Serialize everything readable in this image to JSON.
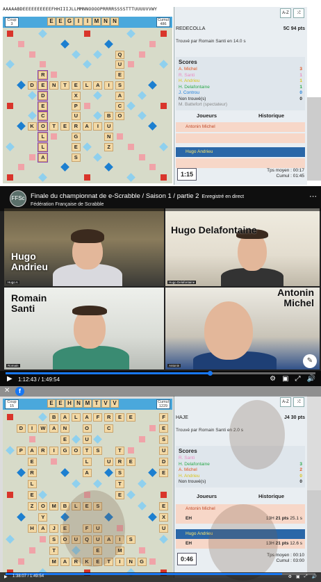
{
  "game1": {
    "letter_pool": "AAAAABDEEEEEEEEEEFHHIIIJLLMMNNOOOOPRRRRSSSSTTTUUUUVVWY",
    "coup_label": "Coup",
    "coup_value": "3",
    "cumul_label": "Cumul",
    "cumul_value": "486",
    "rack": [
      "E",
      "E",
      "G",
      "I",
      "I",
      "M",
      "N",
      "N"
    ],
    "board": [
      {
        "r": 2,
        "c": 10,
        "t": "Q"
      },
      {
        "r": 3,
        "c": 10,
        "t": "U"
      },
      {
        "r": 4,
        "c": 10,
        "t": "E"
      },
      {
        "r": 4,
        "c": 3,
        "t": "R"
      },
      {
        "r": 5,
        "c": 3,
        "t": "E"
      },
      {
        "r": 5,
        "c": 2,
        "t": "D"
      },
      {
        "r": 5,
        "c": 4,
        "t": "N"
      },
      {
        "r": 5,
        "c": 5,
        "t": "T"
      },
      {
        "r": 5,
        "c": 6,
        "t": "E"
      },
      {
        "r": 5,
        "c": 7,
        "t": "L"
      },
      {
        "r": 5,
        "c": 8,
        "t": "A"
      },
      {
        "r": 5,
        "c": 9,
        "t": "I"
      },
      {
        "r": 5,
        "c": 10,
        "t": "S"
      },
      {
        "r": 6,
        "c": 3,
        "t": "D"
      },
      {
        "r": 6,
        "c": 6,
        "t": "X"
      },
      {
        "r": 6,
        "c": 10,
        "t": "A"
      },
      {
        "r": 7,
        "c": 3,
        "t": "E"
      },
      {
        "r": 7,
        "c": 6,
        "t": "P"
      },
      {
        "r": 7,
        "c": 10,
        "t": "C"
      },
      {
        "r": 8,
        "c": 3,
        "t": "C"
      },
      {
        "r": 8,
        "c": 6,
        "t": "U"
      },
      {
        "r": 8,
        "c": 9,
        "t": "B"
      },
      {
        "r": 8,
        "c": 10,
        "t": "O"
      },
      {
        "r": 9,
        "c": 2,
        "t": "K"
      },
      {
        "r": 9,
        "c": 3,
        "t": "O"
      },
      {
        "r": 9,
        "c": 4,
        "t": "T"
      },
      {
        "r": 9,
        "c": 5,
        "t": "E"
      },
      {
        "r": 9,
        "c": 6,
        "t": "R"
      },
      {
        "r": 9,
        "c": 7,
        "t": "A"
      },
      {
        "r": 9,
        "c": 8,
        "t": "I"
      },
      {
        "r": 9,
        "c": 9,
        "t": "U"
      },
      {
        "r": 10,
        "c": 3,
        "t": "L"
      },
      {
        "r": 10,
        "c": 6,
        "t": "G"
      },
      {
        "r": 10,
        "c": 9,
        "t": "N"
      },
      {
        "r": 11,
        "c": 3,
        "t": "L"
      },
      {
        "r": 11,
        "c": 6,
        "t": "E"
      },
      {
        "r": 11,
        "c": 9,
        "t": "Z"
      },
      {
        "r": 12,
        "c": 3,
        "t": "A"
      },
      {
        "r": 12,
        "c": 6,
        "t": "S"
      }
    ],
    "highlight_col": 3,
    "highlight_rows": [
      4,
      12
    ],
    "word": "REDECOLLA",
    "position": "5C",
    "points": "94 pts",
    "found_by": "Trouvé par Romain Santi en 14.0 s",
    "scores_title": "Scores",
    "scores": [
      {
        "name": "A. Michel",
        "value": "3",
        "color": "#e0541f"
      },
      {
        "name": "R. Santi",
        "value": "1",
        "color": "#e98ac0"
      },
      {
        "name": "H. Andrieu",
        "value": "1",
        "color": "#d9c41a"
      },
      {
        "name": "H. Delafontaine",
        "value": "1",
        "color": "#2aa84a"
      },
      {
        "name": "J. Controu",
        "value": "0",
        "color": "#1f7fd8"
      },
      {
        "name": "Non trouvé(s)",
        "value": "0",
        "color": "#222"
      },
      {
        "name": "M. Battefort (spectateur)",
        "value": "",
        "color": "#888"
      }
    ],
    "joueurs_label": "Joueurs",
    "historique_label": "Historique",
    "player1": "Antonin Michel",
    "player2": "Hugo Andrieu",
    "timer": "1:15",
    "tps_moyen": "Tps moyen : 00:17",
    "cumul_time": "Cumul : 01:45",
    "sort_btn": "A-Z",
    "shuffle_btn": "⤮"
  },
  "video": {
    "title": "Finale du championnat de e-Scrabble / Saison 1 / partie 2",
    "live": "Enregistré en direct",
    "subtitle": "Fédération Française de Scrabble",
    "cams": [
      {
        "name": "Hugo\nAndrieu",
        "tag": "Hugo A"
      },
      {
        "name": "Hugo Delafontaine",
        "tag": "Hugo Delafontaine"
      },
      {
        "name": "Romain\nSanti",
        "tag": "Romain"
      },
      {
        "name": "Antonin\nMichel",
        "tag": "Antonin"
      }
    ],
    "time": "1:12:43 / 1:49:54",
    "progress": 0.66,
    "logo": "FFSc"
  },
  "game2": {
    "coup_label": "Coup",
    "coup_value": "15",
    "cumul_label": "Cumul",
    "cumul_value": "1229",
    "rack": [
      "E",
      "E",
      "H",
      "N",
      "M",
      "T",
      "V",
      "V"
    ],
    "board": [
      {
        "r": 0,
        "c": 4,
        "t": "B"
      },
      {
        "r": 0,
        "c": 5,
        "t": "A"
      },
      {
        "r": 0,
        "c": 6,
        "t": "L"
      },
      {
        "r": 0,
        "c": 7,
        "t": "A"
      },
      {
        "r": 0,
        "c": 8,
        "t": "F"
      },
      {
        "r": 0,
        "c": 9,
        "t": "R"
      },
      {
        "r": 0,
        "c": 10,
        "t": "E"
      },
      {
        "r": 0,
        "c": 11,
        "t": "E"
      },
      {
        "r": 0,
        "c": 14,
        "t": "F"
      },
      {
        "r": 1,
        "c": 1,
        "t": "D"
      },
      {
        "r": 1,
        "c": 2,
        "t": "I"
      },
      {
        "r": 1,
        "c": 3,
        "t": "W"
      },
      {
        "r": 1,
        "c": 4,
        "t": "A"
      },
      {
        "r": 1,
        "c": 5,
        "t": "N"
      },
      {
        "r": 1,
        "c": 7,
        "t": "O"
      },
      {
        "r": 1,
        "c": 9,
        "t": "C"
      },
      {
        "r": 1,
        "c": 14,
        "t": "E"
      },
      {
        "r": 2,
        "c": 5,
        "t": "E"
      },
      {
        "r": 2,
        "c": 7,
        "t": "U"
      },
      {
        "r": 2,
        "c": 14,
        "t": "S"
      },
      {
        "r": 3,
        "c": 1,
        "t": "P"
      },
      {
        "r": 3,
        "c": 2,
        "t": "A"
      },
      {
        "r": 3,
        "c": 3,
        "t": "R"
      },
      {
        "r": 3,
        "c": 4,
        "t": "I"
      },
      {
        "r": 3,
        "c": 5,
        "t": "G"
      },
      {
        "r": 3,
        "c": 6,
        "t": "O"
      },
      {
        "r": 3,
        "c": 7,
        "t": "T"
      },
      {
        "r": 3,
        "c": 8,
        "t": "S"
      },
      {
        "r": 3,
        "c": 10,
        "t": "T"
      },
      {
        "r": 3,
        "c": 14,
        "t": "U"
      },
      {
        "r": 4,
        "c": 2,
        "t": "E"
      },
      {
        "r": 4,
        "c": 7,
        "t": "L"
      },
      {
        "r": 4,
        "c": 9,
        "t": "U"
      },
      {
        "r": 4,
        "c": 10,
        "t": "R"
      },
      {
        "r": 4,
        "c": 11,
        "t": "E"
      },
      {
        "r": 4,
        "c": 14,
        "t": "D"
      },
      {
        "r": 5,
        "c": 2,
        "t": "R"
      },
      {
        "r": 5,
        "c": 7,
        "t": "A"
      },
      {
        "r": 5,
        "c": 10,
        "t": "S"
      },
      {
        "r": 5,
        "c": 14,
        "t": "E"
      },
      {
        "r": 6,
        "c": 2,
        "t": "L"
      },
      {
        "r": 6,
        "c": 10,
        "t": "T"
      },
      {
        "r": 7,
        "c": 2,
        "t": "E"
      },
      {
        "r": 7,
        "c": 10,
        "t": "E"
      },
      {
        "r": 8,
        "c": 2,
        "t": "Z"
      },
      {
        "r": 8,
        "c": 3,
        "t": "O"
      },
      {
        "r": 8,
        "c": 4,
        "t": "M"
      },
      {
        "r": 8,
        "c": 5,
        "t": "B"
      },
      {
        "r": 8,
        "c": 6,
        "t": "L"
      },
      {
        "r": 8,
        "c": 7,
        "t": "E"
      },
      {
        "r": 8,
        "c": 8,
        "t": "S"
      },
      {
        "r": 8,
        "c": 14,
        "t": "E"
      },
      {
        "r": 9,
        "c": 3,
        "t": "Y"
      },
      {
        "r": 9,
        "c": 14,
        "t": "X"
      },
      {
        "r": 10,
        "c": 2,
        "t": "H"
      },
      {
        "r": 10,
        "c": 3,
        "t": "A"
      },
      {
        "r": 10,
        "c": 4,
        "t": "J"
      },
      {
        "r": 10,
        "c": 5,
        "t": "E"
      },
      {
        "r": 10,
        "c": 7,
        "t": "F"
      },
      {
        "r": 10,
        "c": 8,
        "t": "U"
      },
      {
        "r": 10,
        "c": 14,
        "t": "U"
      },
      {
        "r": 11,
        "c": 4,
        "t": "S"
      },
      {
        "r": 11,
        "c": 5,
        "t": "O"
      },
      {
        "r": 11,
        "c": 6,
        "t": "U"
      },
      {
        "r": 11,
        "c": 7,
        "t": "Q"
      },
      {
        "r": 11,
        "c": 8,
        "t": "U"
      },
      {
        "r": 11,
        "c": 9,
        "t": "A"
      },
      {
        "r": 11,
        "c": 10,
        "t": "I"
      },
      {
        "r": 11,
        "c": 11,
        "t": "S"
      },
      {
        "r": 12,
        "c": 4,
        "t": "T"
      },
      {
        "r": 12,
        "c": 8,
        "t": "E"
      },
      {
        "r": 12,
        "c": 10,
        "t": "M"
      },
      {
        "r": 13,
        "c": 4,
        "t": "M"
      },
      {
        "r": 13,
        "c": 5,
        "t": "A"
      },
      {
        "r": 13,
        "c": 6,
        "t": "R"
      },
      {
        "r": 13,
        "c": 7,
        "t": "K"
      },
      {
        "r": 13,
        "c": 8,
        "t": "E"
      },
      {
        "r": 13,
        "c": 9,
        "t": "T"
      },
      {
        "r": 13,
        "c": 10,
        "t": "I"
      },
      {
        "r": 13,
        "c": 11,
        "t": "N"
      },
      {
        "r": 13,
        "c": 12,
        "t": "G"
      }
    ],
    "word": "HAJE",
    "position": "J4",
    "points": "30 pts",
    "found_by": "Trouvé par Romain Santi en 2.0 s",
    "scores_title": "Scores",
    "scores": [
      {
        "name": "R. Santi",
        "value": "",
        "color": "#e98ac0"
      },
      {
        "name": "H. Delafontaine",
        "value": "3",
        "color": "#2aa84a"
      },
      {
        "name": "A. Michel",
        "value": "2",
        "color": "#e0541f"
      },
      {
        "name": "H. Andrieu",
        "value": "0",
        "color": "#d9c41a"
      },
      {
        "name": "Non trouvé(s)",
        "value": "0",
        "color": "#222"
      }
    ],
    "joueurs_label": "Joueurs",
    "historique_label": "Historique",
    "player1": "Antonin Michel",
    "player1_word": "EH",
    "player1_pos": "13H",
    "player1_pts": "21 pts",
    "player1_time": "25.1 s",
    "player2": "Hugo Andrieu",
    "player2_word": "EH",
    "player2_pos": "13H",
    "player2_pts": "21 pts",
    "player2_time": "12.6 s",
    "timer": "0:46",
    "tps_moyen": "Tps moyen : 00:10",
    "cumul_time": "Cumul : 03:00",
    "sort_btn": "A-Z",
    "shuffle_btn": "⤮",
    "video_time": "1:38:07 / 1:49:54",
    "progress": 0.893
  }
}
